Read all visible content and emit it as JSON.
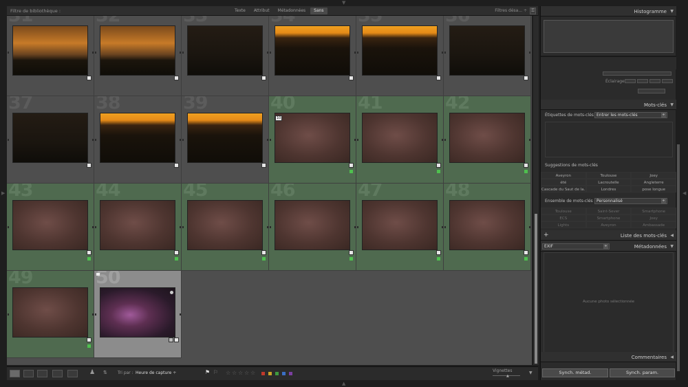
{
  "filterbar": {
    "title": "Filtre de bibliothèque :",
    "tabs": [
      "Texte",
      "Attribut",
      "Métadonnées",
      "Sans"
    ],
    "active_tab": "Sans",
    "presets": "Filtres désa... ÷"
  },
  "grid": {
    "cells": [
      {
        "num": "31",
        "type": "dusk",
        "stack": false,
        "selected": false
      },
      {
        "num": "32",
        "type": "dusk",
        "stack": false,
        "selected": false
      },
      {
        "num": "33",
        "type": "dark",
        "stack": false,
        "selected": false
      },
      {
        "num": "34",
        "type": "sunset",
        "stack": false,
        "selected": false
      },
      {
        "num": "35",
        "type": "sunset",
        "stack": false,
        "selected": false
      },
      {
        "num": "36",
        "type": "dark",
        "stack": false,
        "selected": false
      },
      {
        "num": "37",
        "type": "dark",
        "stack": false,
        "selected": false
      },
      {
        "num": "38",
        "type": "sunset",
        "stack": false,
        "selected": false
      },
      {
        "num": "39",
        "type": "sunset",
        "stack": false,
        "selected": false
      },
      {
        "num": "40",
        "type": "mw",
        "stack": true,
        "selected": false,
        "tag": "10"
      },
      {
        "num": "41",
        "type": "mw",
        "stack": true,
        "selected": false
      },
      {
        "num": "42",
        "type": "mw",
        "stack": true,
        "selected": false
      },
      {
        "num": "43",
        "type": "mw",
        "stack": true,
        "selected": false
      },
      {
        "num": "44",
        "type": "mw",
        "stack": true,
        "selected": false
      },
      {
        "num": "45",
        "type": "mw",
        "stack": true,
        "selected": false
      },
      {
        "num": "46",
        "type": "mw",
        "stack": true,
        "selected": false
      },
      {
        "num": "47",
        "type": "mw",
        "stack": true,
        "selected": false
      },
      {
        "num": "48",
        "type": "mw",
        "stack": true,
        "selected": false
      },
      {
        "num": "49",
        "type": "mw",
        "stack": true,
        "selected": false
      },
      {
        "num": "50",
        "type": "mw2",
        "stack": false,
        "selected": true
      }
    ]
  },
  "toolbar": {
    "sort_label": "Tri par :",
    "sort_value": "Heure de capture ÷",
    "thumb_label": "Vignettes",
    "color_labels": [
      "#c0392b",
      "#c9a227",
      "#3e9a3e",
      "#3a6fc4",
      "#7b3fa0"
    ]
  },
  "panel": {
    "histogram": "Histogramme",
    "exposure_label": "Éclairage",
    "keywords_header": "Mots-clés",
    "keyword_tags_label": "Étiquettes de mots-clés",
    "keyword_tags_value": "Entrer les mots-clés",
    "suggestions_label": "Suggestions de mots-clés",
    "suggestions": [
      "Aveyron",
      "Toulouse",
      "Joey",
      "été",
      "Lacroutelle",
      "Angleterre",
      "Cascade du Saut de la...",
      "Londres",
      "pose longue"
    ],
    "set_label": "Ensemble de mots-clés",
    "set_value": "Personnalisé",
    "set_items": [
      "Toulouse",
      "Saint-Sever",
      "Smartphone",
      "ECS",
      "Smartphone",
      "Joey",
      "Lights",
      "Aveyron",
      "Ambassade"
    ],
    "list_header": "Liste des mots-clés",
    "meta_select": "EXIF",
    "meta_header": "Métadonnées",
    "meta_empty": "Aucune photo sélectionnée",
    "comments": "Commentaires",
    "sync_meta": "Synch. métad.",
    "sync_params": "Synch. param."
  }
}
